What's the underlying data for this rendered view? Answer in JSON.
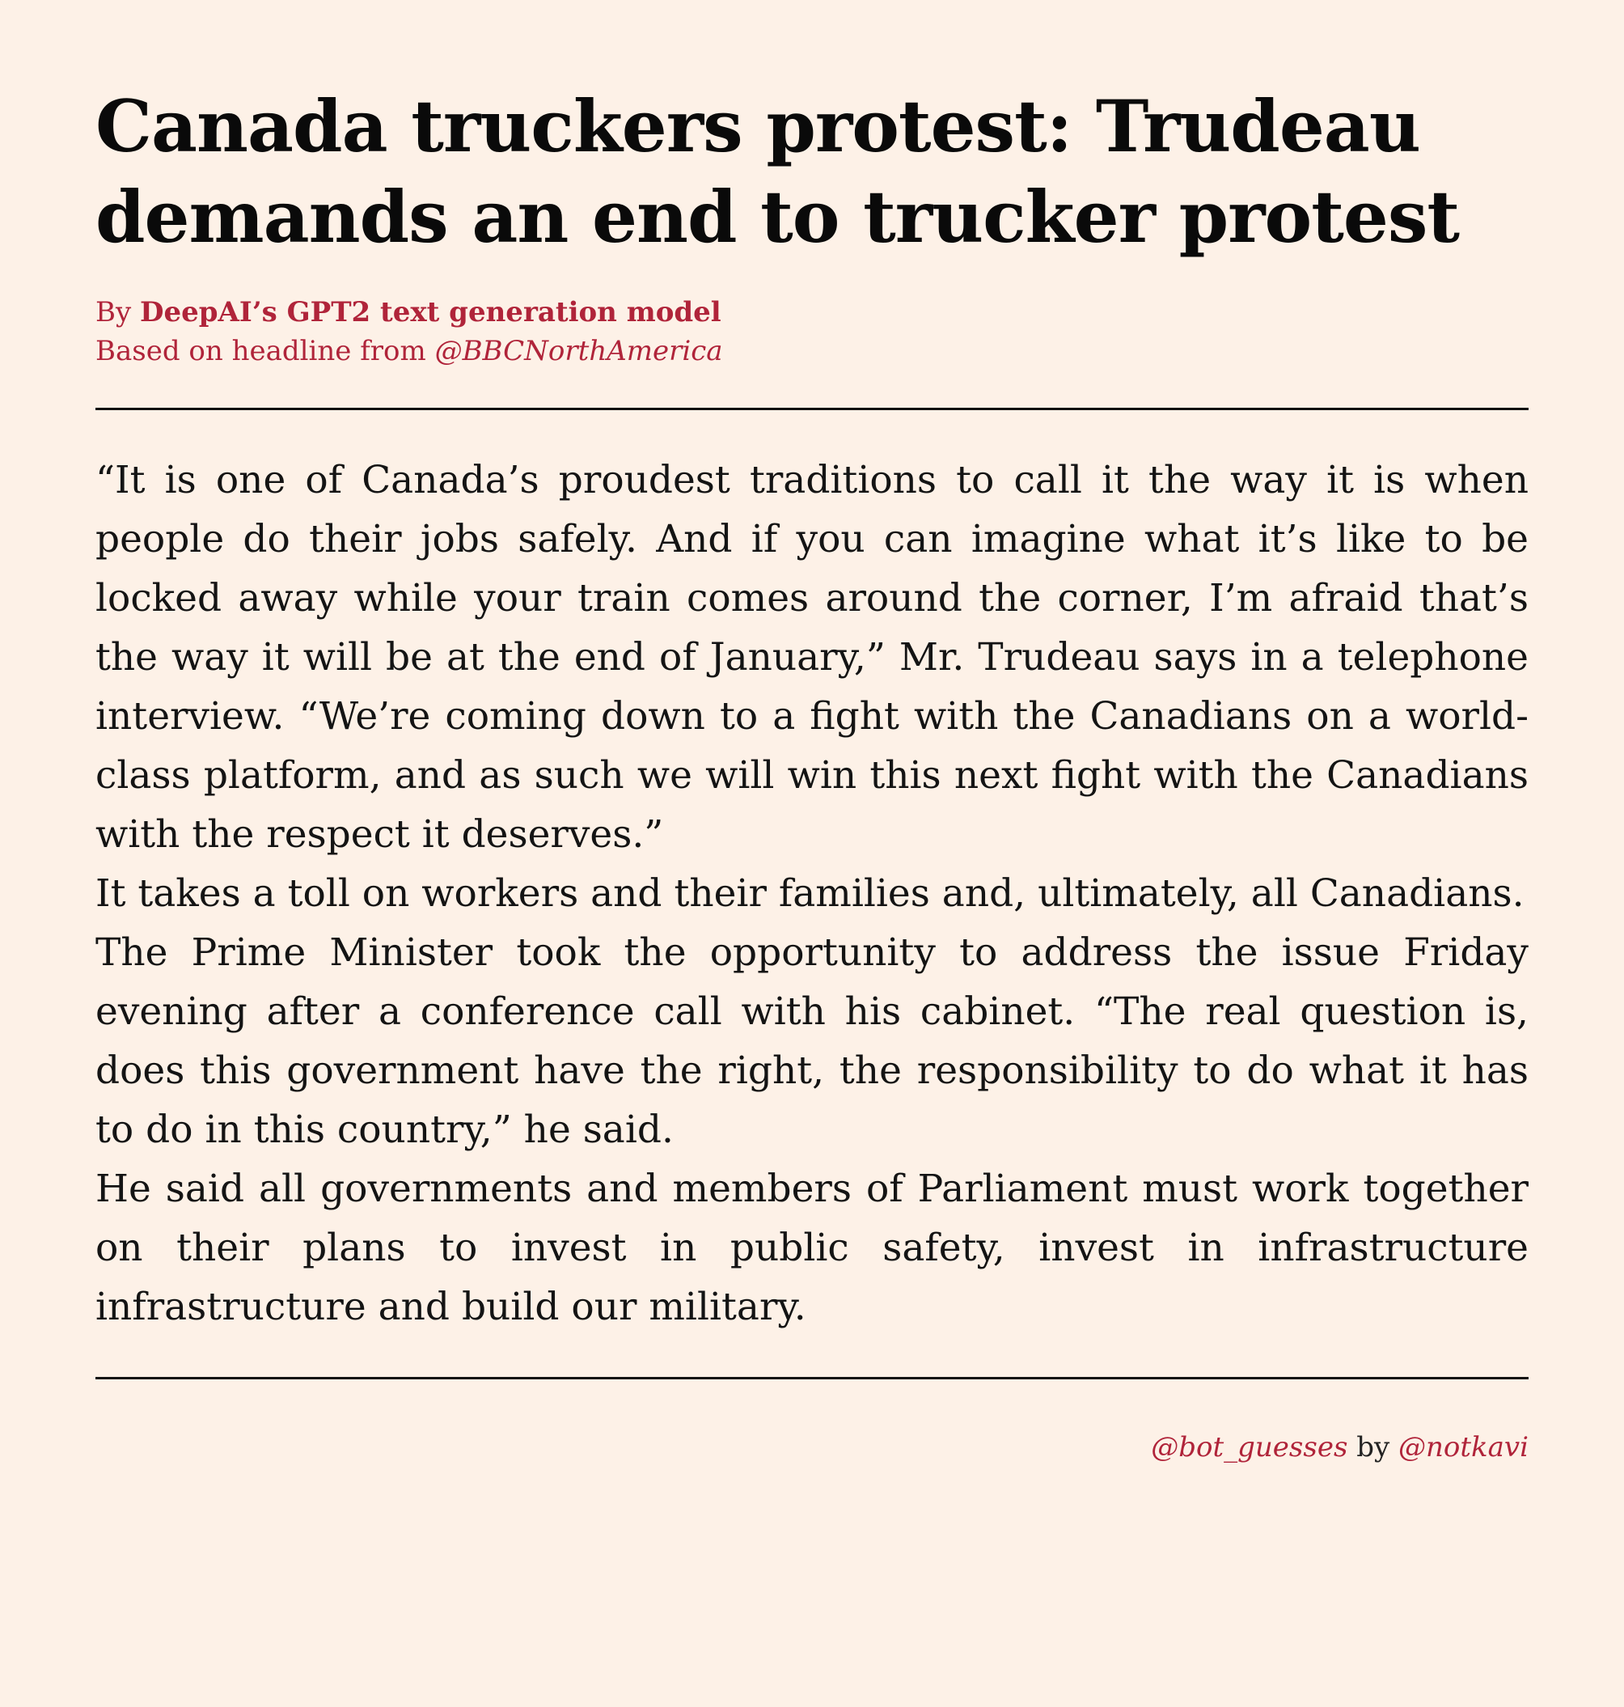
{
  "article": {
    "headline": "Canada truckers protest: Trudeau demands an end to trucker protest",
    "byline_prefix": "By ",
    "byline_author": "DeepAI’s GPT2 text generation model",
    "source_prefix": "Based on headline from ",
    "source_handle": "@BBCNorthAmerica",
    "paragraphs": [
      "“It is one of Canada’s proudest traditions to call it the way it is when people do their jobs safely. And if you can imagine what it’s like to be locked away while your train comes around the corner, I’m afraid that’s the way it will be at the end of January,” Mr. Trudeau says in a telephone interview. “We’re coming down to a fight with the Canadians on a world-class platform, and as such we will win this next fight with the Canadians with the respect it deserves.”",
      "It takes a toll on workers and their families and, ultimately, all Canadians.",
      "The Prime Minister took the opportunity to address the issue Friday evening after a conference call with his cabinet. “The real question is, does this government have the right, the responsibility to do what it has to do in this country,” he said.",
      "He said all governments and members of Parliament must work together on their plans to invest in public safety, invest in infrastructure infrastructure and build our military."
    ]
  },
  "footer": {
    "bot_handle": "@bot_guesses",
    "by_word": " by ",
    "author_handle": "@notkavi"
  },
  "colors": {
    "background": "#fdf1e7",
    "accent": "#b0243a",
    "text": "#111111"
  }
}
